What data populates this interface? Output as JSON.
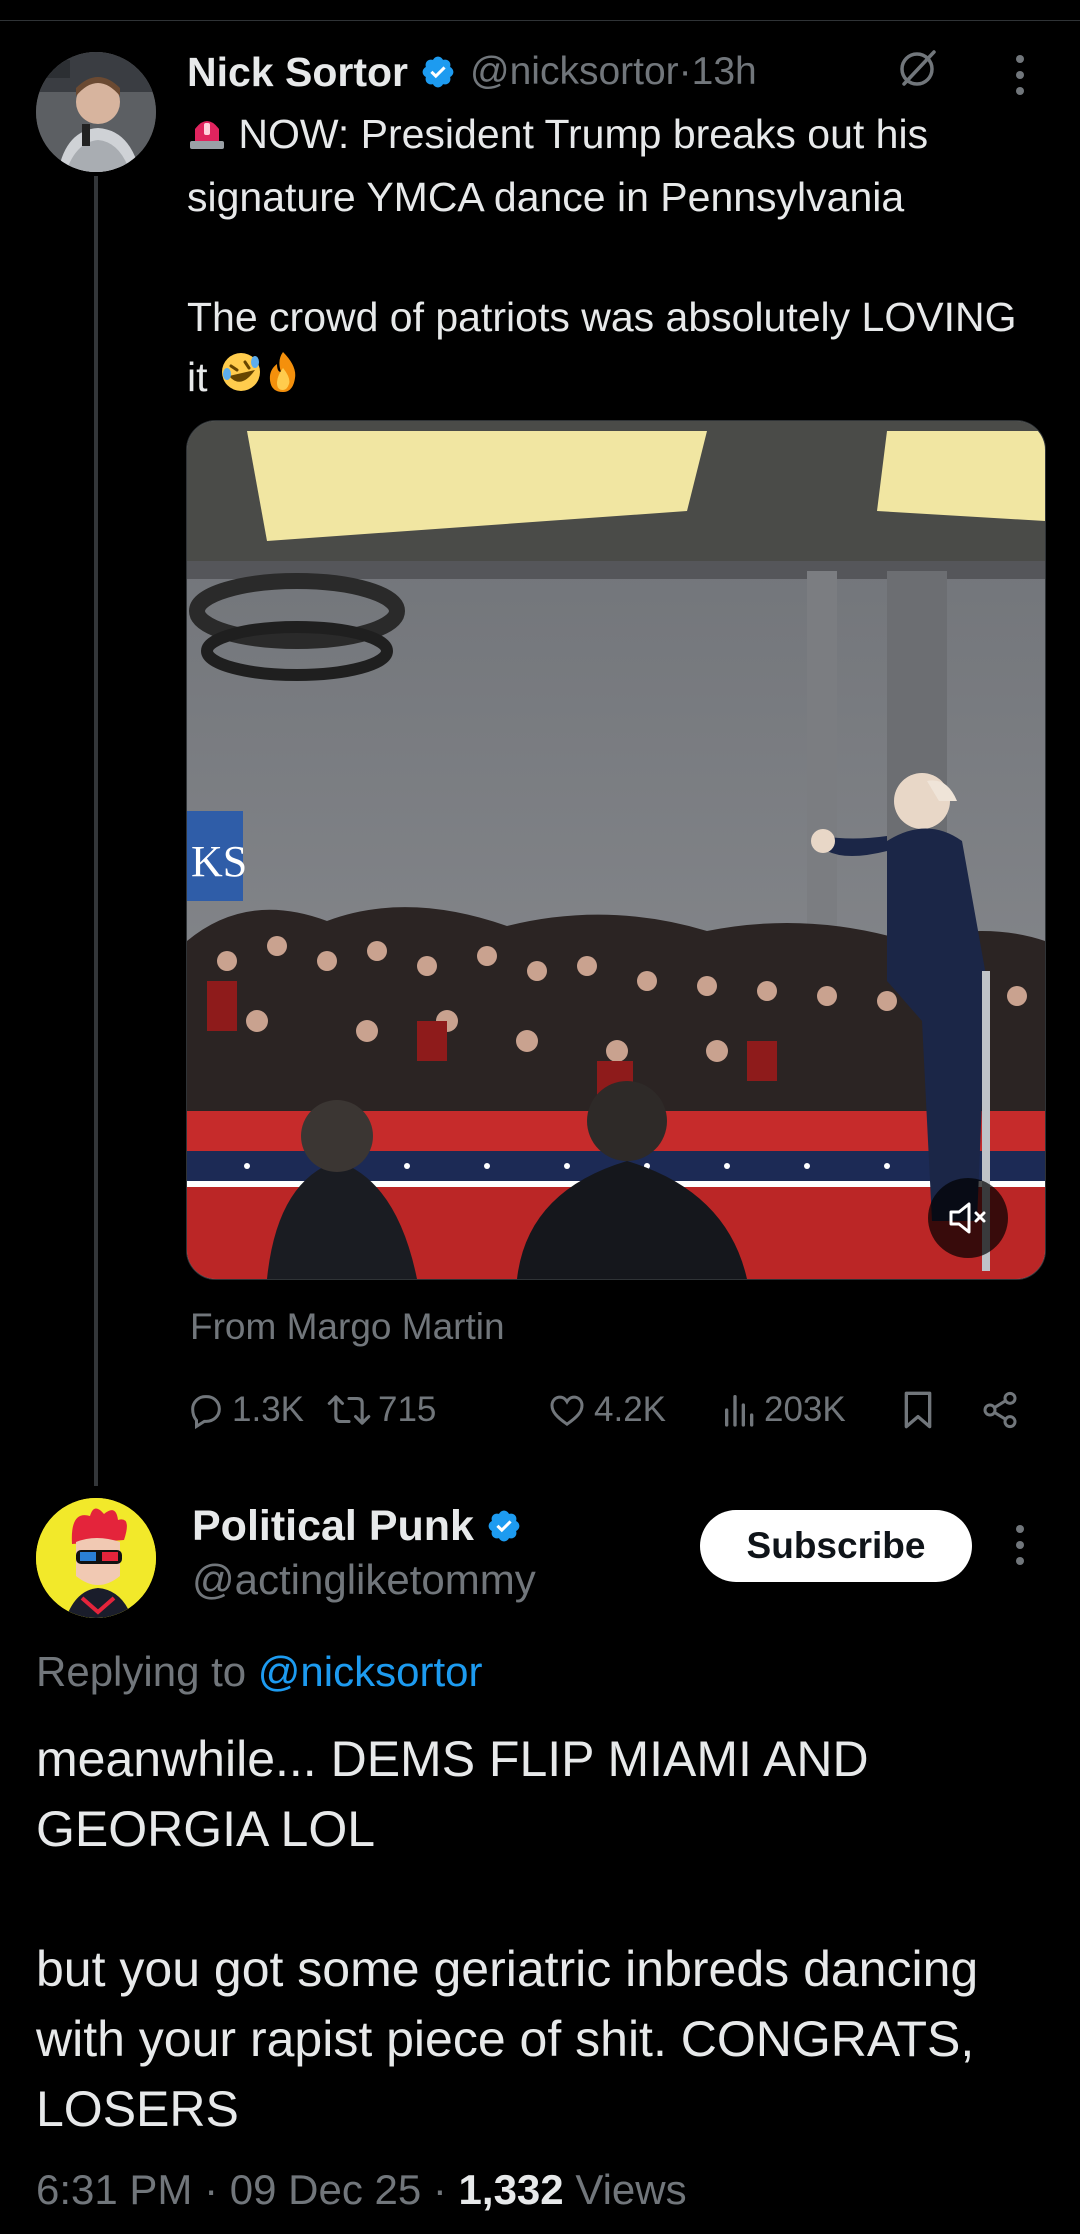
{
  "parent_tweet": {
    "author_name": "Nick Sortor",
    "handle": "@nicksortor",
    "separator": " · ",
    "time_ago": "13h",
    "text_line1": " NOW: President Trump breaks out his signature YMCA dance in Pennsylvania",
    "text_line2": "The crowd of patriots was absolutely LOVING it",
    "media_caption": "From Margo Martin",
    "media_banner_text": "KS",
    "stats": {
      "replies": "1.3K",
      "reposts": "715",
      "likes": "4.2K",
      "views": "203K"
    },
    "icons": [
      "verified-badge-icon",
      "grok-icon",
      "more-icon",
      "siren-emoji",
      "rofl-emoji",
      "fire-emoji",
      "mute-icon",
      "reply-icon",
      "repost-icon",
      "like-icon",
      "views-icon",
      "bookmark-icon",
      "share-icon"
    ]
  },
  "reply_tweet": {
    "author_name": "Political Punk",
    "handle": "@actingliketommy",
    "subscribe_label": "Subscribe",
    "replying_to_prefix": "Replying to ",
    "replying_to_handle": "@nicksortor",
    "text_para1": "meanwhile... DEMS FLIP MIAMI AND GEORGIA LOL",
    "text_para2": "but you got some geriatric inbreds dancing with your rapist piece of shit. CONGRATS, LOSERS",
    "time": "6:31 PM",
    "date": "09 Dec 25",
    "view_count": "1,332",
    "views_label": " Views",
    "meta_separator": " · "
  },
  "colors": {
    "background": "#000000",
    "text_primary": "#e7e9ea",
    "text_secondary": "#71767b",
    "link": "#1d9bf0",
    "divider": "#2f3336"
  }
}
